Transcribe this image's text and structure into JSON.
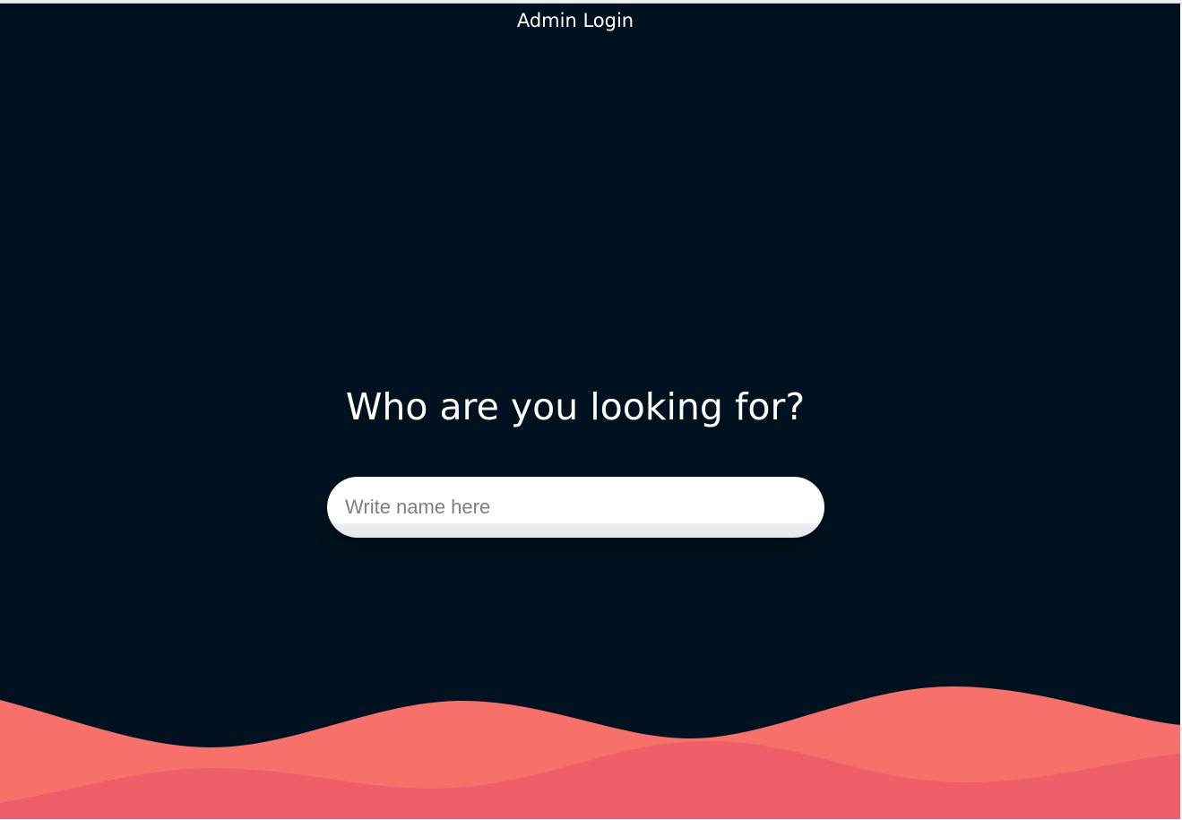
{
  "nav": {
    "admin_login": "Admin Login"
  },
  "hero": {
    "headline": "Who are you looking for?"
  },
  "search": {
    "placeholder": "Write name here",
    "value": ""
  },
  "colors": {
    "background": "#001220",
    "wave_front": "#f7716a",
    "wave_back": "#ef5f67",
    "text": "#ffffff"
  }
}
